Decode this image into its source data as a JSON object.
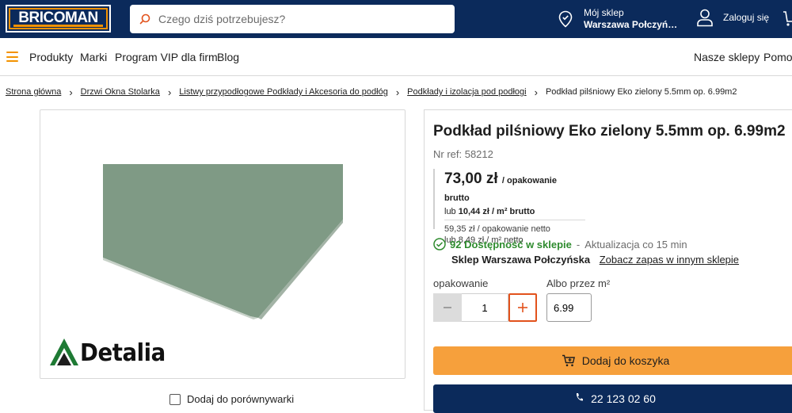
{
  "header": {
    "logo_text": "BRICOMAN",
    "search_placeholder": "Czego dziś potrzebujesz?",
    "store_label": "Mój sklep",
    "store_name": "Warszawa Połczyń…",
    "login_label": "Zaloguj się"
  },
  "nav": {
    "items": [
      "Produkty",
      "Marki",
      "Program VIP dla firm",
      "Blog"
    ],
    "right_items": [
      "Nasze sklepy",
      "Pomoc"
    ]
  },
  "breadcrumb": [
    "Strona główna",
    "Drzwi Okna Stolarka",
    "Listwy przypodłogowe Podkłady i Akcesoria do podłóg",
    "Podkłady i izolacja pod podłogi",
    "Podkład pilśniowy Eko zielony 5.5mm op. 6.99m2"
  ],
  "product": {
    "brand_logo_text": "Detalia",
    "compare_label": "Dodaj do porównywarki",
    "title": "Podkład pilśniowy Eko zielony 5.5mm op. 6.99m2",
    "ref": "Nr ref: 58212",
    "price": "73,00 zł",
    "price_unit": "/ opakowanie brutto",
    "price_m2_prefix": "lub",
    "price_m2_value": "10,44 zł / m² brutto",
    "net_pack": "59,35 zł / opakowanie netto",
    "net_m2": "lub 8,49 zł / m² netto",
    "availability_count": "92 Dostępność w sklepie",
    "availability_dash": "-",
    "availability_update": "Aktualizacja co 15 min",
    "store_name": "Sklep Warszawa Połczyńska",
    "other_store_link": "Zobacz zapas w innym sklepie",
    "pack_label": "opakowanie",
    "m2_label": "Albo przez m²",
    "quantity": "1",
    "m2_value": "6.99",
    "add_to_cart": "Dodaj do koszyka",
    "phone": "22 123 02 60"
  },
  "colors": {
    "navy": "#0b2a5b",
    "orange": "#f39200",
    "button_orange": "#f6a03c",
    "green": "#2e8b2e",
    "plus_border": "#e2521c"
  }
}
